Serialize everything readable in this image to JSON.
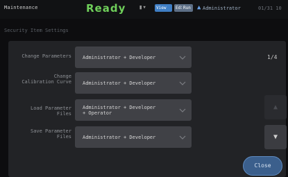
{
  "header": {
    "mode": "Maintenance",
    "status": "Ready",
    "badges": [
      "View",
      "Edit",
      "Run"
    ],
    "user": "Administrator",
    "clock": "01/31 10"
  },
  "page": {
    "title": "Security Item Settings",
    "page_indicator": "1/4",
    "close_label": "Close"
  },
  "settings": [
    {
      "label": "Change Parameters",
      "value": "Administrator + Developer"
    },
    {
      "label": "Change\nCalibration Curve",
      "value": "Administrator + Developer"
    },
    {
      "label": "Load Parameter\nFiles",
      "value": "Administrator + Developer\n+ Operator"
    },
    {
      "label": "Save Parameter\nFiles",
      "value": "Administrator + Developer"
    }
  ],
  "colors": {
    "status_ready": "#6fcf5a",
    "badge_blue": "#3f7ec4",
    "close_button": "#3b5f8c"
  },
  "icons": [
    "tool-menu-icon",
    "user-icon",
    "chevron-down-icon",
    "scroll-up-icon",
    "scroll-down-icon"
  ]
}
